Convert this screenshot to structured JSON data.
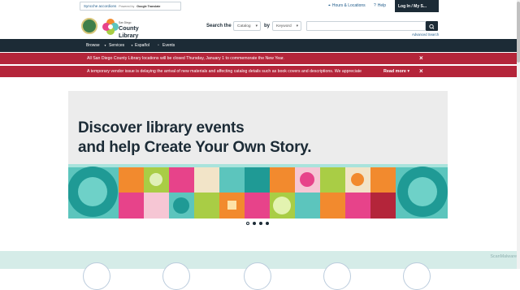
{
  "topbar": {
    "language_select": "Syncche accordions",
    "powered_by": "Powered by",
    "google_translate": "Google Translate",
    "hours_link": "Hours & Locations",
    "help_link": "Help",
    "login": "Log In / My S..."
  },
  "logo": {
    "small_text": "San Diego",
    "name": "County Library"
  },
  "search": {
    "label_search": "Search the",
    "scope": "Catalog",
    "label_by": "by",
    "field": "Keyword",
    "advanced": "Advanced Search"
  },
  "nav": {
    "items": [
      "Browse",
      "Services",
      "Español",
      "Events"
    ]
  },
  "alerts": [
    {
      "text": "All San Diego County Library locations will be closed Thursday, January 1 to commemorate the New Year."
    },
    {
      "text": "A temporary vendor issue is delaying the arrival of new materials and affecting catalog details such as book covers and descriptions. We appreciate",
      "read_more": "Read more"
    }
  ],
  "hero": {
    "line1": "Discover library events",
    "line2": "and help Create Your Own Story."
  },
  "carousel": {
    "slides": 4,
    "active": 1
  },
  "watermark": "ScanMalware",
  "colors": {
    "navy": "#1c2b36",
    "alert_red": "#b4253a",
    "teal": "#5cc5bd",
    "orange": "#f28a2e",
    "pink": "#e7438a",
    "lime": "#a9cd45"
  }
}
